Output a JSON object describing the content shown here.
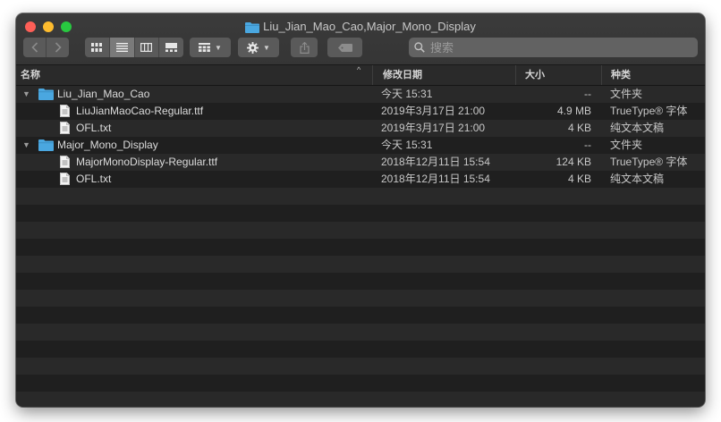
{
  "window": {
    "title": "Liu_Jian_Mao_Cao,Major_Mono_Display"
  },
  "toolbar": {
    "back_icon": "chevron-left-icon",
    "forward_icon": "chevron-right-icon",
    "search_placeholder": "搜索"
  },
  "columns": {
    "name": "名称",
    "date": "修改日期",
    "size": "大小",
    "kind": "种类"
  },
  "files": [
    {
      "name": "Liu_Jian_Mao_Cao",
      "date": "今天 15:31",
      "size": "--",
      "kind": "文件夹",
      "type": "folder"
    },
    {
      "name": "LiuJianMaoCao-Regular.ttf",
      "date": "2019年3月17日 21:00",
      "size": "4.9 MB",
      "kind": "TrueType® 字体",
      "type": "file"
    },
    {
      "name": "OFL.txt",
      "date": "2019年3月17日 21:00",
      "size": "4 KB",
      "kind": "纯文本文稿",
      "type": "file"
    },
    {
      "name": "Major_Mono_Display",
      "date": "今天 15:31",
      "size": "--",
      "kind": "文件夹",
      "type": "folder"
    },
    {
      "name": "MajorMonoDisplay-Regular.ttf",
      "date": "2018年12月11日 15:54",
      "size": "124 KB",
      "kind": "TrueType® 字体",
      "type": "file"
    },
    {
      "name": "OFL.txt",
      "date": "2018年12月11日 15:54",
      "size": "4 KB",
      "kind": "纯文本文稿",
      "type": "file"
    }
  ],
  "colors": {
    "folder": "#4aa7e0",
    "window_bg": "#1f1f1f",
    "stripe": "#292929"
  }
}
